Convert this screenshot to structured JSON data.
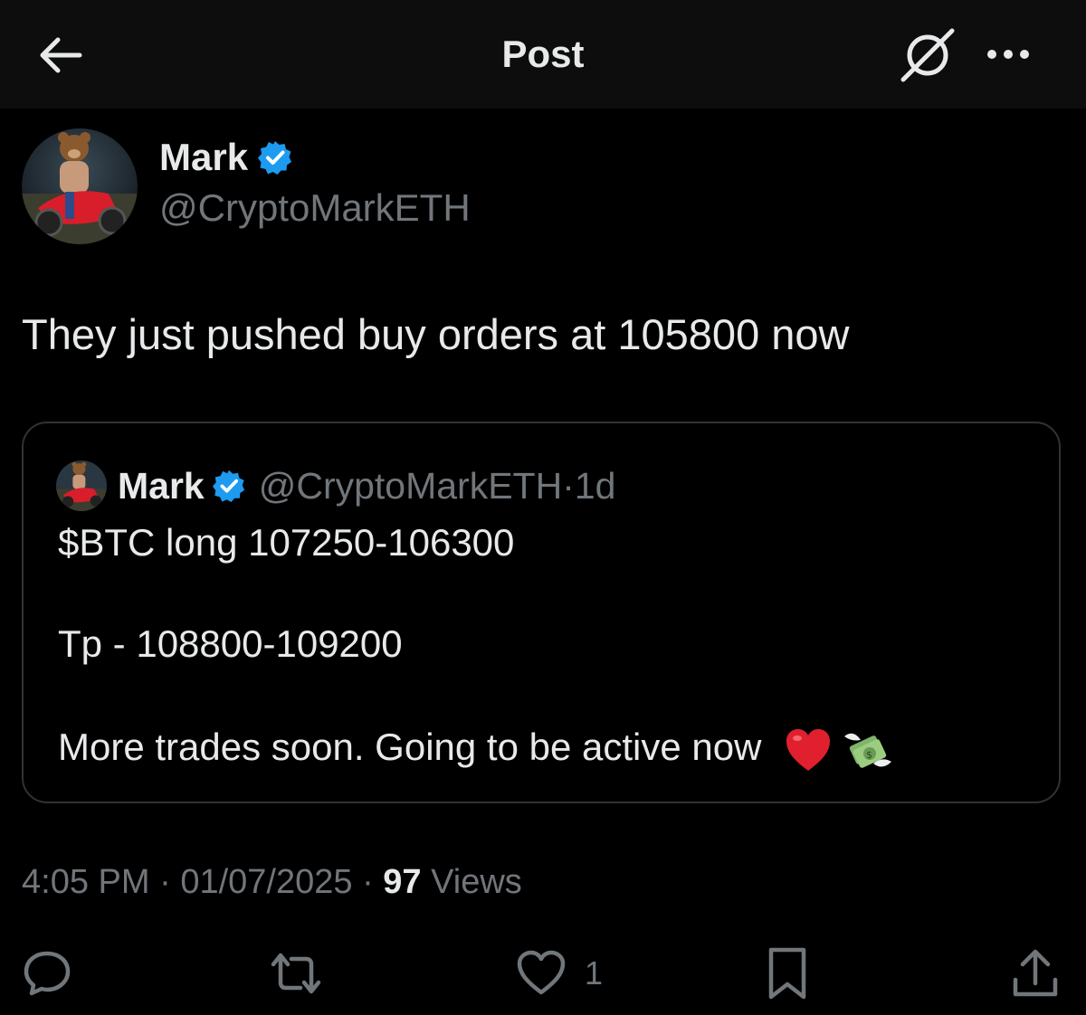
{
  "header": {
    "title": "Post",
    "icons": [
      "back-arrow-icon",
      "grok-icon",
      "more-icon"
    ]
  },
  "author": {
    "name": "Mark",
    "handle": "@CryptoMarkETH",
    "verified": true
  },
  "post": {
    "text": "They just pushed buy orders at 105800 now"
  },
  "quoted_post": {
    "name": "Mark",
    "handle": "@CryptoMarkETH",
    "separator": "·",
    "age": "1d",
    "lines": [
      "$BTC long 107250-106300",
      "Tp - 108800-109200",
      "More trades soon. Going to be active now"
    ],
    "emojis": [
      "red-heart-emoji",
      "money-with-wings-emoji"
    ]
  },
  "meta": {
    "time": "4:05 PM",
    "date": "01/07/2025",
    "separator": "·",
    "views_count": "97",
    "views_label": "Views"
  },
  "actions": {
    "like_count": "1",
    "icons": [
      "reply-icon",
      "repost-icon",
      "like-icon",
      "bookmark-icon",
      "share-icon"
    ]
  },
  "colors": {
    "background": "#000000",
    "topbar": "#0d0d0d",
    "text_primary": "#e7e9ea",
    "text_secondary": "#71767b",
    "verified_blue": "#1d9bf0",
    "border": "#2f3336"
  }
}
